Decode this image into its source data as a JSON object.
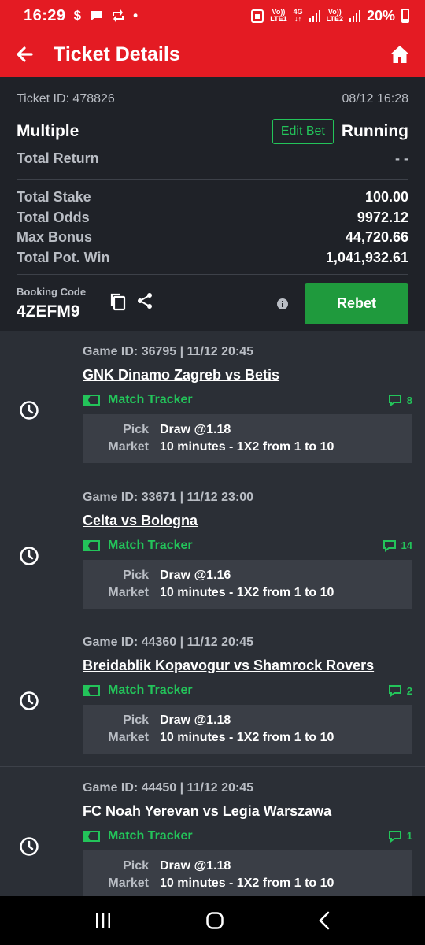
{
  "status_bar": {
    "time": "16:29",
    "icons": [
      "dollar-icon",
      "chat-icon",
      "retweet-icon",
      "dot-icon"
    ],
    "sim1": {
      "top": "Vo))",
      "bottom": "LTE1",
      "net": "4G"
    },
    "sim2": {
      "top": "Vo))",
      "bottom": "LTE2"
    },
    "battery": "20%",
    "battery_level": 0.2
  },
  "header": {
    "title": "Ticket Details",
    "back_icon": "arrow-left-icon",
    "home_icon": "home-icon"
  },
  "ticket": {
    "id_label": "Ticket ID: 478826",
    "datetime": "08/12 16:28",
    "type": "Multiple",
    "edit_bet_label": "Edit Bet",
    "status": "Running",
    "total_return_label": "Total Return",
    "total_return_value": "- -",
    "totals": [
      {
        "label": "Total Stake",
        "value": "100.00"
      },
      {
        "label": "Total Odds",
        "value": "9972.12"
      },
      {
        "label": "Max Bonus",
        "value": "44,720.66"
      },
      {
        "label": "Total Pot. Win",
        "value": "1,041,932.61"
      }
    ],
    "booking_label": "Booking Code",
    "booking_code": "4ZEFM9",
    "rebet_label": "Rebet"
  },
  "games": [
    {
      "gid": "Game ID: 36795 | 11/12 20:45",
      "teams": "GNK Dinamo Zagreb vs Betis",
      "tracker": "Match Tracker",
      "comments": "8",
      "pick_label": "Pick",
      "pick": "Draw @1.18",
      "market_label": "Market",
      "market": "10 minutes - 1X2 from 1 to 10"
    },
    {
      "gid": "Game ID: 33671 | 11/12 23:00",
      "teams": "Celta vs Bologna",
      "tracker": "Match Tracker",
      "comments": "14",
      "pick_label": "Pick",
      "pick": "Draw @1.16",
      "market_label": "Market",
      "market": "10 minutes - 1X2 from 1 to 10"
    },
    {
      "gid": "Game ID: 44360 | 11/12 20:45",
      "teams": "Breidablik Kopavogur vs Shamrock Rovers",
      "tracker": "Match Tracker",
      "comments": "2",
      "pick_label": "Pick",
      "pick": "Draw @1.18",
      "market_label": "Market",
      "market": "10 minutes - 1X2 from 1 to 10"
    },
    {
      "gid": "Game ID: 44450 | 11/12 20:45",
      "teams": "FC Noah Yerevan vs Legia Warszawa",
      "tracker": "Match Tracker",
      "comments": "1",
      "pick_label": "Pick",
      "pick": "Draw @1.18",
      "market_label": "Market",
      "market": "10 minutes - 1X2 from 1 to 10"
    }
  ],
  "navbar": {
    "icons": [
      "recent-apps-icon",
      "home-circle-icon",
      "back-chevron-icon"
    ]
  },
  "colors": {
    "brand_red": "#e41b23",
    "accent_green": "#23c45a",
    "rebet_green": "#1f9a3d",
    "panel_dark": "#1f2228",
    "card_dark": "#2b2f36"
  }
}
